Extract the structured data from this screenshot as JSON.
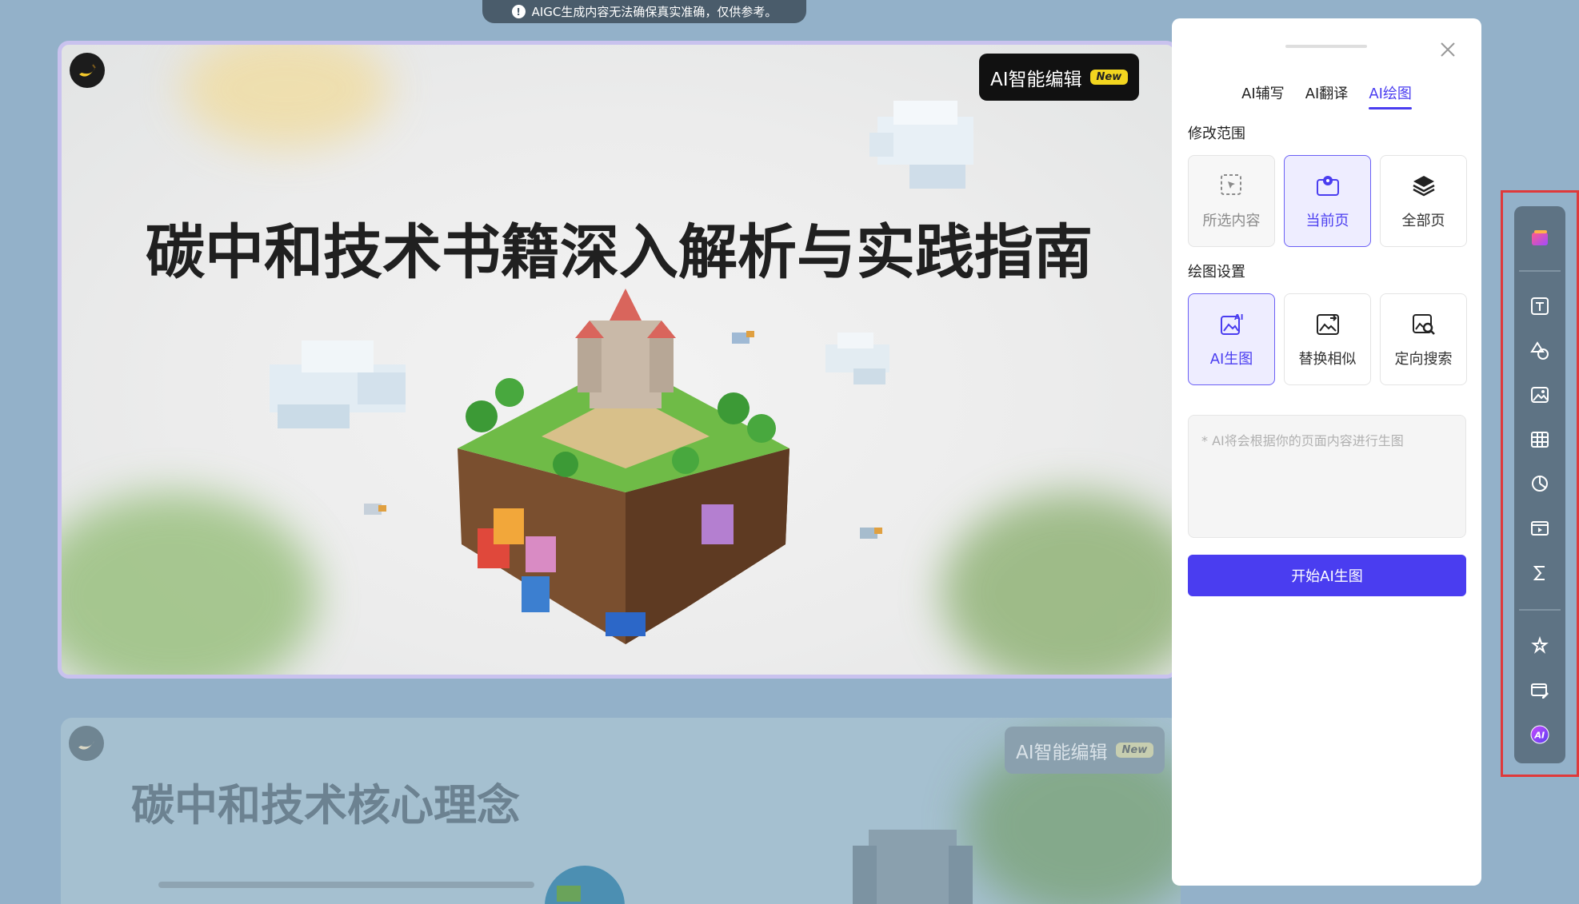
{
  "notice": {
    "text": "AIGC生成内容无法确保真实准确，仅供参考。"
  },
  "slides": [
    {
      "title": "碳中和技术书籍深入解析与实践指南",
      "badge": "AI智能编辑",
      "badge_tag": "New"
    },
    {
      "title": "碳中和技术核心理念",
      "badge": "AI智能编辑",
      "badge_tag": "New"
    }
  ],
  "panel": {
    "tabs": [
      {
        "label": "AI辅写",
        "active": false
      },
      {
        "label": "AI翻译",
        "active": false
      },
      {
        "label": "AI绘图",
        "active": true
      }
    ],
    "scope_label": "修改范围",
    "scope_options": [
      {
        "label": "所选内容",
        "icon": "cursor-select-icon",
        "state": "disabled"
      },
      {
        "label": "当前页",
        "icon": "current-page-icon",
        "state": "selected"
      },
      {
        "label": "全部页",
        "icon": "layers-icon",
        "state": "normal"
      }
    ],
    "draw_label": "绘图设置",
    "draw_options": [
      {
        "label": "AI生图",
        "icon": "ai-image-icon",
        "state": "selected"
      },
      {
        "label": "替换相似",
        "icon": "replace-image-icon",
        "state": "normal"
      },
      {
        "label": "定向搜索",
        "icon": "image-search-icon",
        "state": "normal"
      }
    ],
    "prompt_placeholder": "* AI将会根据你的页面内容进行生图",
    "start_button": "开始AI生图"
  },
  "toolbar": {
    "items": [
      "template-icon",
      "text-icon",
      "shapes-icon",
      "image-icon",
      "table-icon",
      "chart-icon",
      "media-icon",
      "formula-icon",
      "magic-icon",
      "card-edit-icon",
      "ai-icon"
    ]
  },
  "colors": {
    "accent": "#4a3df0",
    "badge_tag": "#f2d51f",
    "toolbar": "#5e7384",
    "highlight_box": "#e0393a"
  }
}
